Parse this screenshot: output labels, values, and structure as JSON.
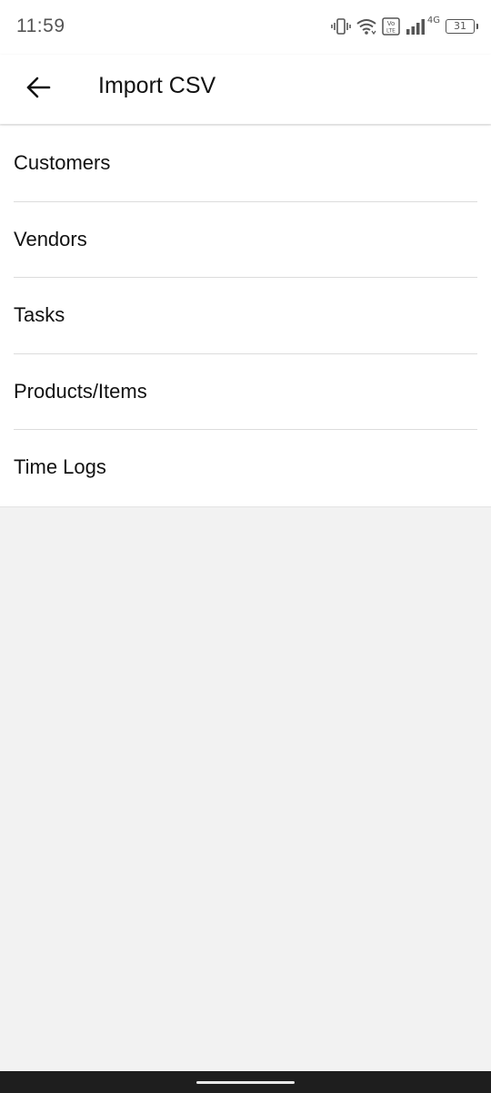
{
  "status_bar": {
    "time": "11:59",
    "network_type": "4G",
    "battery_level": "31",
    "volte_label": "Vo LTE",
    "icons": [
      "vibrate-icon",
      "wifi-icon",
      "volte-icon",
      "signal-icon",
      "battery-icon"
    ]
  },
  "app_bar": {
    "back_icon": "arrow-left-icon",
    "title": "Import CSV"
  },
  "list": {
    "items": [
      {
        "label": "Customers"
      },
      {
        "label": "Vendors"
      },
      {
        "label": "Tasks"
      },
      {
        "label": "Products/Items"
      },
      {
        "label": "Time Logs"
      }
    ]
  },
  "colors": {
    "app_bar_bg": "#ffffff",
    "screen_bg": "#f2f2f2",
    "nav_bar_bg": "#1e1e1e"
  }
}
